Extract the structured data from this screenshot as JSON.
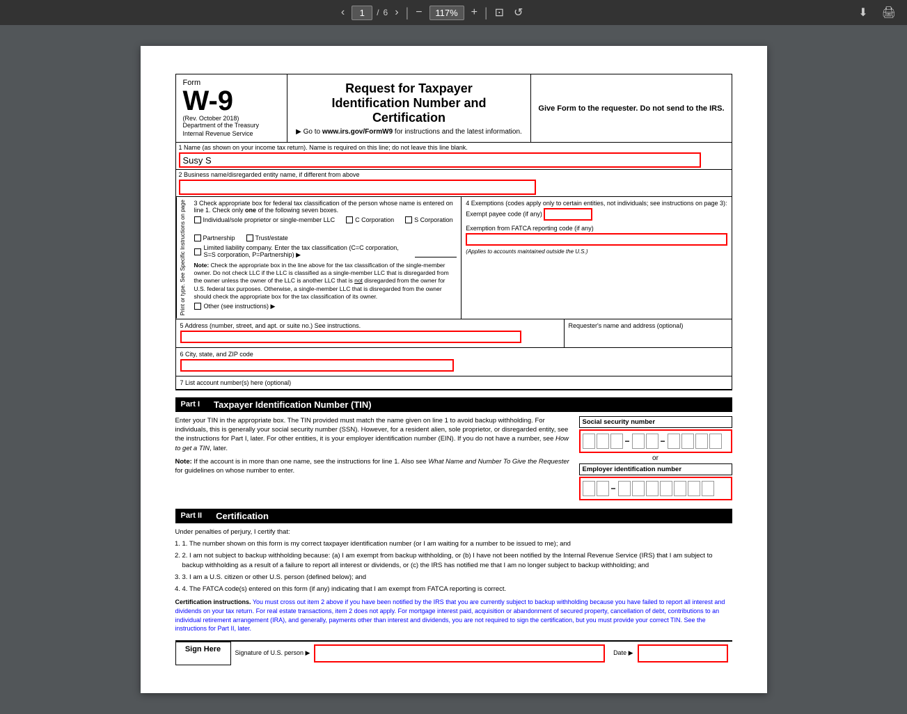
{
  "toolbar": {
    "page_current": "1",
    "page_total": "6",
    "zoom": "117%",
    "download_icon": "⬇",
    "print_icon": "🖨",
    "zoom_out": "−",
    "zoom_in": "+",
    "fit_icon": "⊡",
    "rotate_icon": "↺"
  },
  "form": {
    "form_label": "Form",
    "form_number": "W-9",
    "form_rev": "(Rev. October 2018)",
    "form_dept1": "Department of the Treasury",
    "form_dept2": "Internal Revenue Service",
    "title_main": "Request for Taxpayer",
    "title_sub": "Identification Number and Certification",
    "title_url": "▶ Go to www.irs.gov/FormW9 for instructions and the latest information.",
    "give_form": "Give Form to the requester. Do not send to the IRS.",
    "field1_label": "1  Name (as shown on your income tax return). Name is required on this line; do not leave this line blank.",
    "field1_value": "Susy S",
    "field2_label": "2  Business name/disregarded entity name, if different from above",
    "field2_value": "",
    "tax_class_label": "3  Check appropriate box for federal tax classification of the person whose name is entered on line 1. Check only one of the following seven boxes.",
    "check_only": "Check only",
    "cb_individual": "Individual/sole proprietor or single-member LLC",
    "cb_ccorp": "C Corporation",
    "cb_scorp": "S Corporation",
    "cb_partnership": "Partnership",
    "cb_trust": "Trust/estate",
    "llc_label": "Limited liability company. Enter the tax classification (C=C corporation, S=S corporation, P=Partnership) ▶",
    "llc_line": "______",
    "note_bold": "Note:",
    "note_text": " Check the appropriate box in the line above for the tax classification of the single-member owner.  Do not check LLC if the LLC is classified as a single-member LLC that is disregarded from the owner unless the owner of the LLC is another LLC that is not disregarded from the owner for U.S. federal tax purposes. Otherwise, a single-member LLC that is disregarded from the owner should check the appropriate box for the tax classification of its owner.",
    "not_disregarded": "not",
    "other_label": "Other (see instructions) ▶",
    "exemptions_label": "4  Exemptions (codes apply only to certain entities, not individuals; see instructions on page 3):",
    "exempt_payee_label": "Exempt payee code (if any)",
    "fatca_label": "Exemption from FATCA reporting code (if any)",
    "fatca_note": "(Applies to accounts maintained outside the U.S.)",
    "field5_label": "5  Address (number, street, and apt. or suite no.) See instructions.",
    "requester_label": "Requester's name and address (optional)",
    "field6_label": "6  City, state, and ZIP code",
    "field7_label": "7  List account number(s) here (optional)",
    "sidebar_text": "Print or type. See Specific Instructions on page",
    "do_not_check": "Do not check",
    "part1_label": "Part I",
    "part1_title": "Taxpayer Identification Number (TIN)",
    "part1_body1": "Enter your TIN in the appropriate box. The TIN provided must match the name given on line 1 to avoid backup withholding. For individuals, this is generally your social security number (SSN). However, for a resident alien, sole proprietor, or disregarded entity, see the instructions for Part I, later. For other entities, it is your employer identification number (EIN). If you do not have a number, see ",
    "part1_italic1": "How to get a TIN",
    "part1_body2": ", later.",
    "part1_note_bold": "Note:",
    "part1_note": " If the account is in more than one name, see the instructions for line 1. Also see ",
    "part1_italic2": "What Name and Number To Give the Requester",
    "part1_note2": " for guidelines on whose number to enter.",
    "ssn_label": "Social security number",
    "or_text": "or",
    "ein_label": "Employer identification number",
    "part2_label": "Part II",
    "part2_title": "Certification",
    "cert_intro": "Under penalties of perjury, I certify that:",
    "cert1": "1. The number shown on this form is my correct taxpayer identification number (or I am waiting for a number to be issued to me); and",
    "cert2": "2. I am not subject to backup withholding because: (a) I am exempt from backup withholding, or (b) I have not been notified by the Internal Revenue Service (IRS) that I am subject to backup withholding as a result of a failure to report all interest or dividends, or (c) the IRS has notified me that I am no longer subject to backup withholding; and",
    "cert3": "3. I am a U.S. citizen or other U.S. person (defined below); and",
    "cert4": "4. The FATCA code(s) entered on this form (if any) indicating that I am exempt from FATCA reporting is correct.",
    "cert_instr_label": "Certification instructions.",
    "cert_instr": " You must cross out item 2 above if you have been notified by the IRS that you are currently subject to backup withholding because you have failed to report all interest and dividends on your tax return. For real estate transactions, item 2 does not apply. For mortgage interest paid, acquisition or abandonment of secured property, cancellation of debt, contributions to an individual retirement arrangement (IRA), and generally, payments other than interest and dividends, you are not required to sign the certification, but you must provide your correct TIN. See the instructions for Part II, later.",
    "sign_here_label": "Sign Here",
    "sig_of_label": "Signature of U.S. person ▶",
    "date_label": "Date ▶"
  }
}
